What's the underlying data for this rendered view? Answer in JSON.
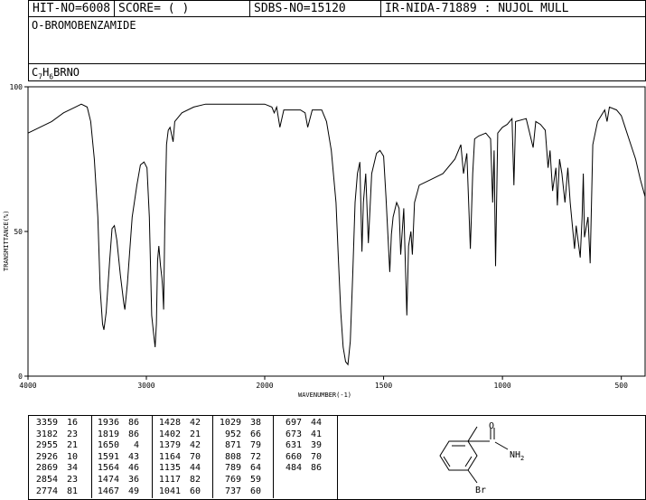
{
  "header": {
    "hit_no": "HIT-NO=6008",
    "score": "SCORE=  (   )",
    "sdbs_no": "SDBS-NO=15120",
    "ir_nida": "IR-NIDA-71889 : NUJOL MULL"
  },
  "compound": {
    "name": "O-BROMOBENZAMIDE",
    "formula_parts": [
      "C",
      "7",
      "H",
      "6",
      "BRNO"
    ]
  },
  "chart_data": {
    "type": "line",
    "xlabel": "WAVENUMBER(-1)",
    "ylabel": "TRANSMITTANCE(%)",
    "x_ticks": [
      4000,
      3000,
      2000,
      1500,
      1000,
      500
    ],
    "y_ticks": [
      0,
      50,
      100
    ],
    "xlim": [
      4000,
      400
    ],
    "ylim": [
      0,
      100
    ],
    "x_scale_break": 2000,
    "series": [
      {
        "points": [
          [
            4000,
            84
          ],
          [
            3900,
            86
          ],
          [
            3800,
            88
          ],
          [
            3700,
            91
          ],
          [
            3600,
            93
          ],
          [
            3550,
            94
          ],
          [
            3500,
            93
          ],
          [
            3470,
            88
          ],
          [
            3440,
            75
          ],
          [
            3410,
            55
          ],
          [
            3390,
            30
          ],
          [
            3370,
            18
          ],
          [
            3359,
            16
          ],
          [
            3340,
            22
          ],
          [
            3310,
            40
          ],
          [
            3290,
            51
          ],
          [
            3270,
            52
          ],
          [
            3250,
            47
          ],
          [
            3220,
            35
          ],
          [
            3190,
            25
          ],
          [
            3182,
            23
          ],
          [
            3160,
            32
          ],
          [
            3120,
            55
          ],
          [
            3080,
            66
          ],
          [
            3050,
            73
          ],
          [
            3020,
            74
          ],
          [
            2995,
            72
          ],
          [
            2975,
            55
          ],
          [
            2955,
            21
          ],
          [
            2940,
            15
          ],
          [
            2926,
            10
          ],
          [
            2915,
            18
          ],
          [
            2905,
            40
          ],
          [
            2895,
            45
          ],
          [
            2880,
            38
          ],
          [
            2869,
            34
          ],
          [
            2862,
            30
          ],
          [
            2854,
            23
          ],
          [
            2845,
            50
          ],
          [
            2830,
            80
          ],
          [
            2815,
            85
          ],
          [
            2800,
            86
          ],
          [
            2774,
            81
          ],
          [
            2760,
            88
          ],
          [
            2700,
            91
          ],
          [
            2600,
            93
          ],
          [
            2500,
            94
          ],
          [
            2400,
            94
          ],
          [
            2300,
            94
          ],
          [
            2200,
            94
          ],
          [
            2100,
            94
          ],
          [
            2000,
            94
          ],
          [
            1970,
            93
          ],
          [
            1960,
            91
          ],
          [
            1950,
            93
          ],
          [
            1936,
            86
          ],
          [
            1920,
            92
          ],
          [
            1900,
            92
          ],
          [
            1850,
            92
          ],
          [
            1830,
            91
          ],
          [
            1819,
            86
          ],
          [
            1800,
            92
          ],
          [
            1760,
            92
          ],
          [
            1740,
            88
          ],
          [
            1720,
            78
          ],
          [
            1700,
            60
          ],
          [
            1690,
            40
          ],
          [
            1680,
            22
          ],
          [
            1670,
            10
          ],
          [
            1660,
            5
          ],
          [
            1650,
            4
          ],
          [
            1640,
            12
          ],
          [
            1630,
            35
          ],
          [
            1620,
            60
          ],
          [
            1610,
            70
          ],
          [
            1600,
            74
          ],
          [
            1591,
            43
          ],
          [
            1585,
            60
          ],
          [
            1575,
            70
          ],
          [
            1564,
            46
          ],
          [
            1550,
            70
          ],
          [
            1530,
            77
          ],
          [
            1515,
            78
          ],
          [
            1500,
            76
          ],
          [
            1490,
            62
          ],
          [
            1474,
            36
          ],
          [
            1467,
            49
          ],
          [
            1460,
            55
          ],
          [
            1445,
            60
          ],
          [
            1435,
            58
          ],
          [
            1428,
            42
          ],
          [
            1415,
            58
          ],
          [
            1402,
            21
          ],
          [
            1395,
            45
          ],
          [
            1385,
            50
          ],
          [
            1379,
            42
          ],
          [
            1370,
            60
          ],
          [
            1350,
            66
          ],
          [
            1300,
            68
          ],
          [
            1250,
            70
          ],
          [
            1200,
            75
          ],
          [
            1175,
            80
          ],
          [
            1164,
            70
          ],
          [
            1150,
            77
          ],
          [
            1135,
            44
          ],
          [
            1125,
            70
          ],
          [
            1117,
            82
          ],
          [
            1100,
            83
          ],
          [
            1070,
            84
          ],
          [
            1050,
            82
          ],
          [
            1041,
            60
          ],
          [
            1035,
            78
          ],
          [
            1029,
            38
          ],
          [
            1020,
            84
          ],
          [
            1000,
            86
          ],
          [
            980,
            87
          ],
          [
            960,
            89
          ],
          [
            952,
            66
          ],
          [
            945,
            88
          ],
          [
            900,
            89
          ],
          [
            871,
            79
          ],
          [
            860,
            88
          ],
          [
            840,
            87
          ],
          [
            820,
            85
          ],
          [
            808,
            72
          ],
          [
            800,
            78
          ],
          [
            789,
            64
          ],
          [
            775,
            72
          ],
          [
            769,
            59
          ],
          [
            760,
            75
          ],
          [
            750,
            70
          ],
          [
            737,
            60
          ],
          [
            725,
            72
          ],
          [
            715,
            60
          ],
          [
            697,
            44
          ],
          [
            690,
            52
          ],
          [
            673,
            41
          ],
          [
            665,
            55
          ],
          [
            660,
            70
          ],
          [
            655,
            48
          ],
          [
            640,
            55
          ],
          [
            631,
            39
          ],
          [
            620,
            80
          ],
          [
            600,
            88
          ],
          [
            570,
            92
          ],
          [
            560,
            88
          ],
          [
            550,
            93
          ],
          [
            520,
            92
          ],
          [
            500,
            90
          ],
          [
            484,
            86
          ],
          [
            460,
            80
          ],
          [
            440,
            75
          ],
          [
            420,
            68
          ],
          [
            400,
            62
          ]
        ]
      }
    ]
  },
  "peak_table": {
    "columns": [
      [
        [
          "3359",
          "16"
        ],
        [
          "3182",
          "23"
        ],
        [
          "2955",
          "21"
        ],
        [
          "2926",
          "10"
        ],
        [
          "2869",
          "34"
        ],
        [
          "2854",
          "23"
        ],
        [
          "2774",
          "81"
        ]
      ],
      [
        [
          "1936",
          "86"
        ],
        [
          "1819",
          "86"
        ],
        [
          "1650",
          "4"
        ],
        [
          "1591",
          "43"
        ],
        [
          "1564",
          "46"
        ],
        [
          "1474",
          "36"
        ],
        [
          "1467",
          "49"
        ]
      ],
      [
        [
          "1428",
          "42"
        ],
        [
          "1402",
          "21"
        ],
        [
          "1379",
          "42"
        ],
        [
          "1164",
          "70"
        ],
        [
          "1135",
          "44"
        ],
        [
          "1117",
          "82"
        ],
        [
          "1041",
          "60"
        ]
      ],
      [
        [
          "1029",
          "38"
        ],
        [
          "952",
          "66"
        ],
        [
          "871",
          "79"
        ],
        [
          "808",
          "72"
        ],
        [
          "789",
          "64"
        ],
        [
          "769",
          "59"
        ],
        [
          "737",
          "60"
        ]
      ],
      [
        [
          "697",
          "44"
        ],
        [
          "673",
          "41"
        ],
        [
          "631",
          "39"
        ],
        [
          "660",
          "70"
        ],
        [
          "484",
          "86"
        ]
      ]
    ]
  },
  "structure": {
    "labels": [
      "O",
      "NH",
      "2",
      "Br"
    ]
  }
}
